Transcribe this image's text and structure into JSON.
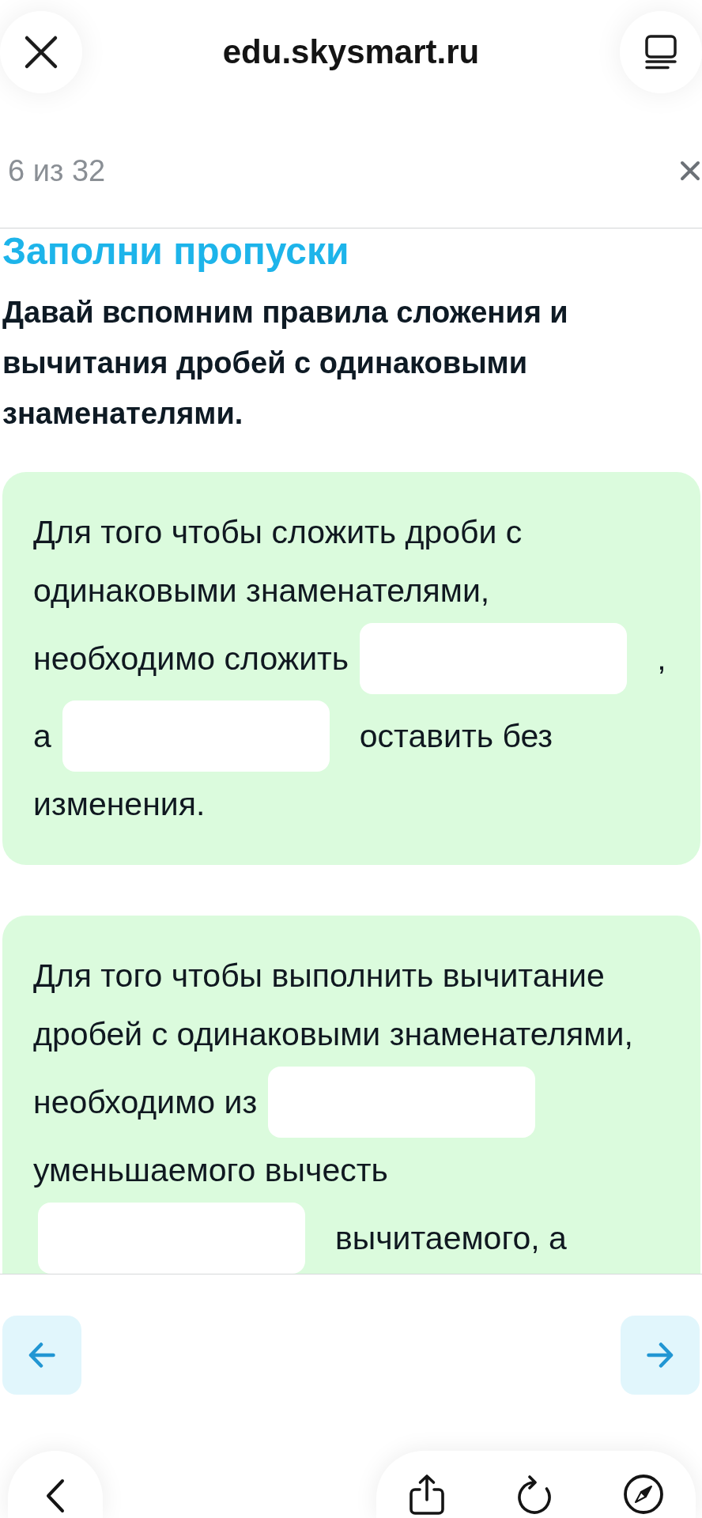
{
  "browser_bar": {
    "url": "edu.skysmart.ru"
  },
  "progress": {
    "counter": "6 из 32"
  },
  "task": {
    "title": "Заполни пропуски",
    "intro": "Давай вспомним правила сложения и вычитания дробей с одинаковыми знаменателями.",
    "exercises": [
      {
        "lines": [
          [
            {
              "kind": "text",
              "text": "Для того чтобы сложить дроби с"
            }
          ],
          [
            {
              "kind": "text",
              "text": "одинаковыми знаменателями,"
            }
          ],
          [
            {
              "kind": "text",
              "text": "необходимо сложить"
            },
            {
              "kind": "blank"
            },
            {
              "kind": "text",
              "text": ","
            }
          ],
          [
            {
              "kind": "text",
              "text": "а"
            },
            {
              "kind": "blank"
            },
            {
              "kind": "text",
              "text": "оставить без"
            }
          ],
          [
            {
              "kind": "text",
              "text": "изменения."
            }
          ]
        ]
      },
      {
        "lines": [
          [
            {
              "kind": "text",
              "text": "Для того чтобы выполнить вычитание"
            }
          ],
          [
            {
              "kind": "text",
              "text": "дробей с одинаковыми знаменателями,"
            }
          ],
          [
            {
              "kind": "text",
              "text": "необходимо из"
            },
            {
              "kind": "blank"
            }
          ],
          [
            {
              "kind": "text",
              "text": "уменьшаемого вычесть"
            }
          ],
          [
            {
              "kind": "blank"
            },
            {
              "kind": "text",
              "text": "вычитаемого, а"
            }
          ]
        ]
      }
    ]
  }
}
